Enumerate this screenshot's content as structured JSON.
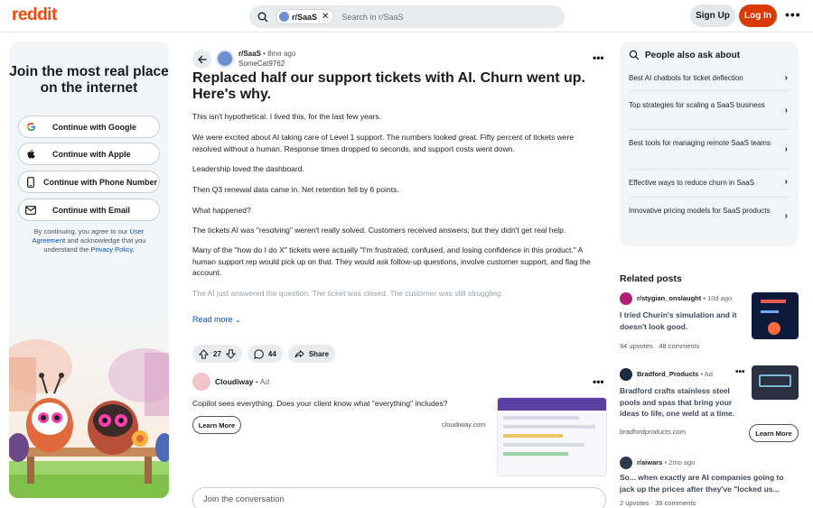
{
  "header": {
    "logo": "reddit",
    "search_chip": "r/SaaS",
    "search_placeholder": "Search in r/SaaS",
    "signup_label": "Sign Up",
    "login_label": "Log In"
  },
  "join_panel": {
    "heading": "Join the most real place on the internet",
    "buttons": [
      {
        "label": "Continue with Google",
        "icon": "google-icon"
      },
      {
        "label": "Continue with Apple",
        "icon": "apple-icon"
      },
      {
        "label": "Continue with Phone Number",
        "icon": "phone-icon"
      },
      {
        "label": "Continue with Email",
        "icon": "email-icon"
      }
    ],
    "fine_1": "By continuing, you agree to our",
    "user_agreement": "User Agreement",
    "fine_2": "and acknowledge that you understand the",
    "privacy_policy": "Privacy Policy",
    "fine_end": "."
  },
  "post": {
    "subreddit": "r/SaaS",
    "age": "• 8mo ago",
    "author": "SomeCat9762",
    "title": "Replaced half our support tickets with AI. Churn went up. Here's why.",
    "paragraphs": [
      "This isn't hypothetical. I lived this, for the last few years.",
      "We were excited about AI taking care of Level 1 support. The numbers looked great. Fifty percent of tickets were resolved without a human. Response times dropped to seconds, and support costs went down.",
      "Leadership loved the dashboard.",
      "Then Q3 renewal data came in. Net retention fell by 6 points.",
      "What happened?",
      "The tickets AI was \"resolving\" weren't really solved. Customers received answers, but they didn't get real help.",
      "Many of the \"how do I do X\" tickets were actually \"I'm frustrated, confused, and losing confidence in this product.\" A human support rep would pick up on that. They would ask follow-up questions, involve customer support, and flag the account.",
      "The AI just answered the question. The ticket was closed. The customer was still struggling."
    ],
    "read_more": "Read more",
    "votes": "27",
    "comments": "44",
    "share": "Share"
  },
  "ad": {
    "advertiser": "Cloudiway",
    "label": "• Ad",
    "text": "Copilot sees everything. Does your client know what \"everything\" includes?",
    "cta": "Learn More",
    "domain": "cloudiway.com"
  },
  "comment_box": {
    "placeholder": "Join the conversation"
  },
  "people_also_ask": {
    "heading": "People also ask about",
    "items": [
      "Best AI chatbots for ticket deflection",
      "Top strategies for scaling a SaaS business",
      "Best tools for managing remote SaaS teams",
      "Effective ways to reduce churn in SaaS",
      "Innovative pricing models for SaaS products"
    ]
  },
  "related": {
    "heading": "Related posts",
    "posts": [
      {
        "sub": "r/stygian_onslaught",
        "age": "• 10d ago",
        "title": "I tried Churin's simulation and it doesn't look good.",
        "upvotes": "94 upvotes",
        "comments": "48 comments"
      },
      {
        "sub": "Bradford_Products",
        "age": "• Ad",
        "title": "Bradford crafts stainless steel pools and spas that bring your ideas to life, one weld at a time.",
        "domain": "bradfordproducts.com",
        "cta": "Learn More"
      },
      {
        "sub": "r/aiwars",
        "age": "• 2mo ago",
        "title": "So... when exactly are AI companies going to jack up the prices after they've \"locked us...",
        "upvotes": "2 upvotes",
        "comments": "39 comments"
      }
    ]
  }
}
